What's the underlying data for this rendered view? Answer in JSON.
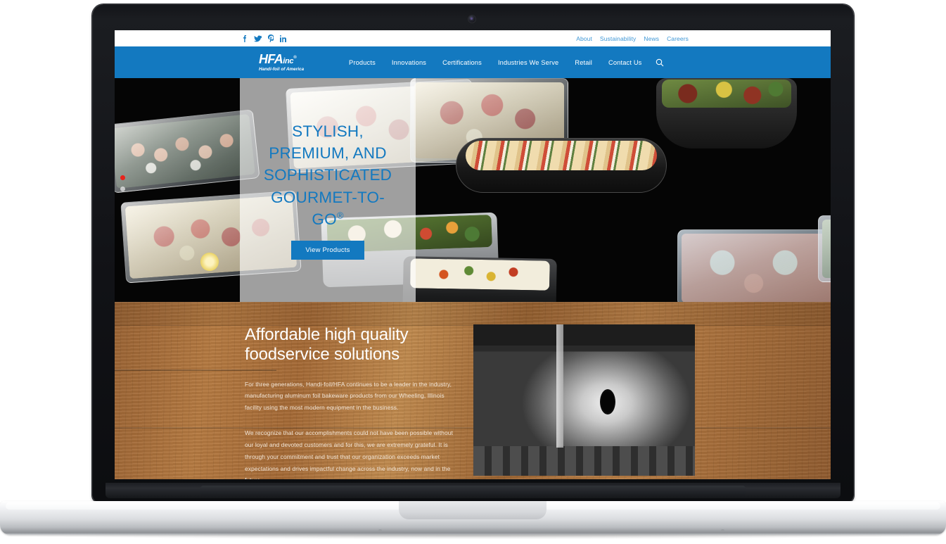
{
  "device": {
    "type": "laptop-mockup",
    "webcam": "webcam-icon"
  },
  "site": {
    "utility_bar": {
      "social": [
        {
          "name": "facebook-icon",
          "label": "f"
        },
        {
          "name": "twitter-icon",
          "label": "t"
        },
        {
          "name": "pinterest-icon",
          "label": "P"
        },
        {
          "name": "linkedin-icon",
          "label": "in"
        }
      ],
      "links": [
        {
          "label": "About"
        },
        {
          "label": "Sustainability"
        },
        {
          "label": "News"
        },
        {
          "label": "Careers"
        }
      ]
    },
    "brand": {
      "mark_main": "HFA",
      "mark_sub": "inc",
      "mark_reg": "®",
      "tagline": "Handi-foil of America"
    },
    "main_nav": {
      "items": [
        {
          "label": "Products"
        },
        {
          "label": "Innovations"
        },
        {
          "label": "Certifications"
        },
        {
          "label": "Industries We Serve"
        },
        {
          "label": "Retail"
        },
        {
          "label": "Contact Us"
        }
      ],
      "search_icon": "search-icon"
    },
    "hero": {
      "headline_lines": [
        "STYLISH,",
        "PREMIUM, AND",
        "SOPHISTICATED",
        "GOURMET-TO-",
        "GO"
      ],
      "headline_superscript": "®",
      "cta_label": "View Products",
      "carousel": {
        "total": 2,
        "active_index": 0
      }
    },
    "content_section": {
      "heading": "Affordable high quality foodservice solutions",
      "paragraph_1": "For three generations, Handi-foil/HFA continues to be a leader in the industry, manufacturing aluminum foil bakeware products from our Wheeling, Illinois facility using the most modern equipment in the business.",
      "paragraph_2": "We recognize that our accomplishments could not have been possible without our loyal and devoted customers and for this, we are extremely grateful. It is through your commitment and trust that our organization exceeds market expectations and drives impactful change across the industry, now and in the future.",
      "image_alt": "aluminum-foil-coils-photo"
    },
    "colors": {
      "brand_blue": "#1379c0",
      "utility_link_blue": "#3e97d6",
      "carousel_active_red": "#e8231c",
      "wood_brown": "#a56a36",
      "hero_overlay": "rgba(255,255,255,0.62)",
      "nav_text": "#ffffff"
    }
  }
}
